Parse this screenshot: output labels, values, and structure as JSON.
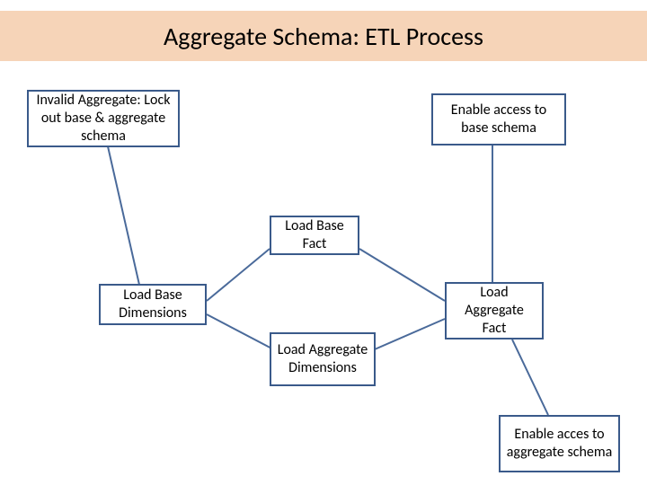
{
  "title": "Aggregate Schema: ETL Process",
  "boxes": {
    "invalidAggregate": "Invalid Aggregate: Lock out base & aggregate schema",
    "enableBase": "Enable access to base schema",
    "loadBaseFact": "Load Base Fact",
    "loadBaseDimensions": "Load Base Dimensions",
    "loadAggregateFact": "Load Aggregate Fact",
    "loadAggregateDimensions": "Load Aggregate Dimensions",
    "enableAggregate": "Enable acces to aggregate schema"
  }
}
